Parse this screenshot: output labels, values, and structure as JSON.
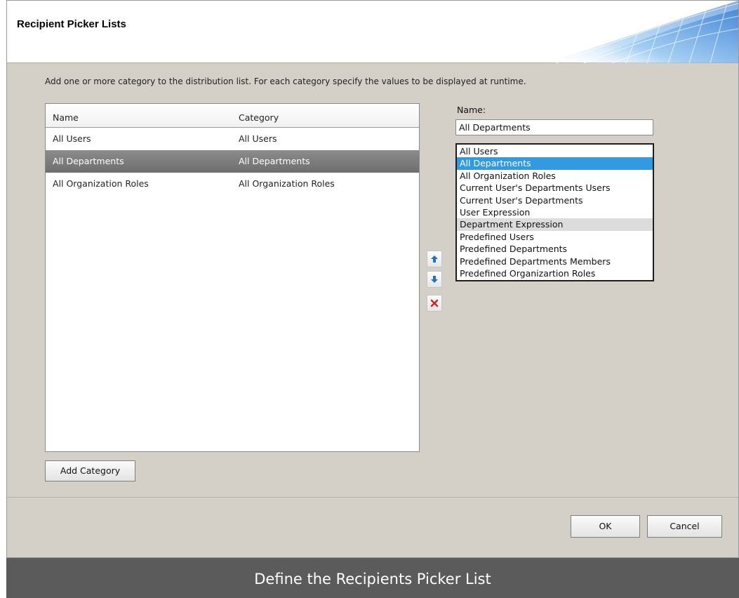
{
  "dialog": {
    "title": "Recipient Picker Lists",
    "instructions": "Add one or more category to the distribution list. For each category specify the values to be displayed at runtime."
  },
  "grid": {
    "columns": [
      "Name",
      "Category"
    ],
    "rows": [
      {
        "name": "All Users",
        "category": "All Users",
        "selected": false
      },
      {
        "name": "All Departments",
        "category": "All Departments",
        "selected": true
      },
      {
        "name": "All Organization Roles",
        "category": "All Organization Roles",
        "selected": false
      }
    ]
  },
  "buttons": {
    "add_category": "Add Category",
    "ok": "OK",
    "cancel": "Cancel"
  },
  "icons": {
    "move_up": "arrow-up-icon",
    "move_down": "arrow-down-icon",
    "delete": "delete-icon"
  },
  "detail": {
    "name_label": "Name:",
    "name_value": "All Departments",
    "category_options": [
      "All Users",
      "All Departments",
      "All Organization Roles",
      "Current User's Departments Users",
      "Current User's Departments",
      "User Expression",
      "Department Expression",
      "Predefined Users",
      "Predefined Departments",
      "Predefined Departments Members",
      "Predefined Organizartion Roles"
    ],
    "selected_option": "All Departments",
    "hovered_option": "Department Expression"
  },
  "colors": {
    "selected_row": "#7d7d7d",
    "selected_option": "#3399e0",
    "dialog_bg": "#d4d0c8",
    "caption_bg": "#5b5b5b",
    "up_down_arrow": "#1f6fd0",
    "delete_x": "#d62424"
  },
  "caption": "Define the Recipients Picker List"
}
